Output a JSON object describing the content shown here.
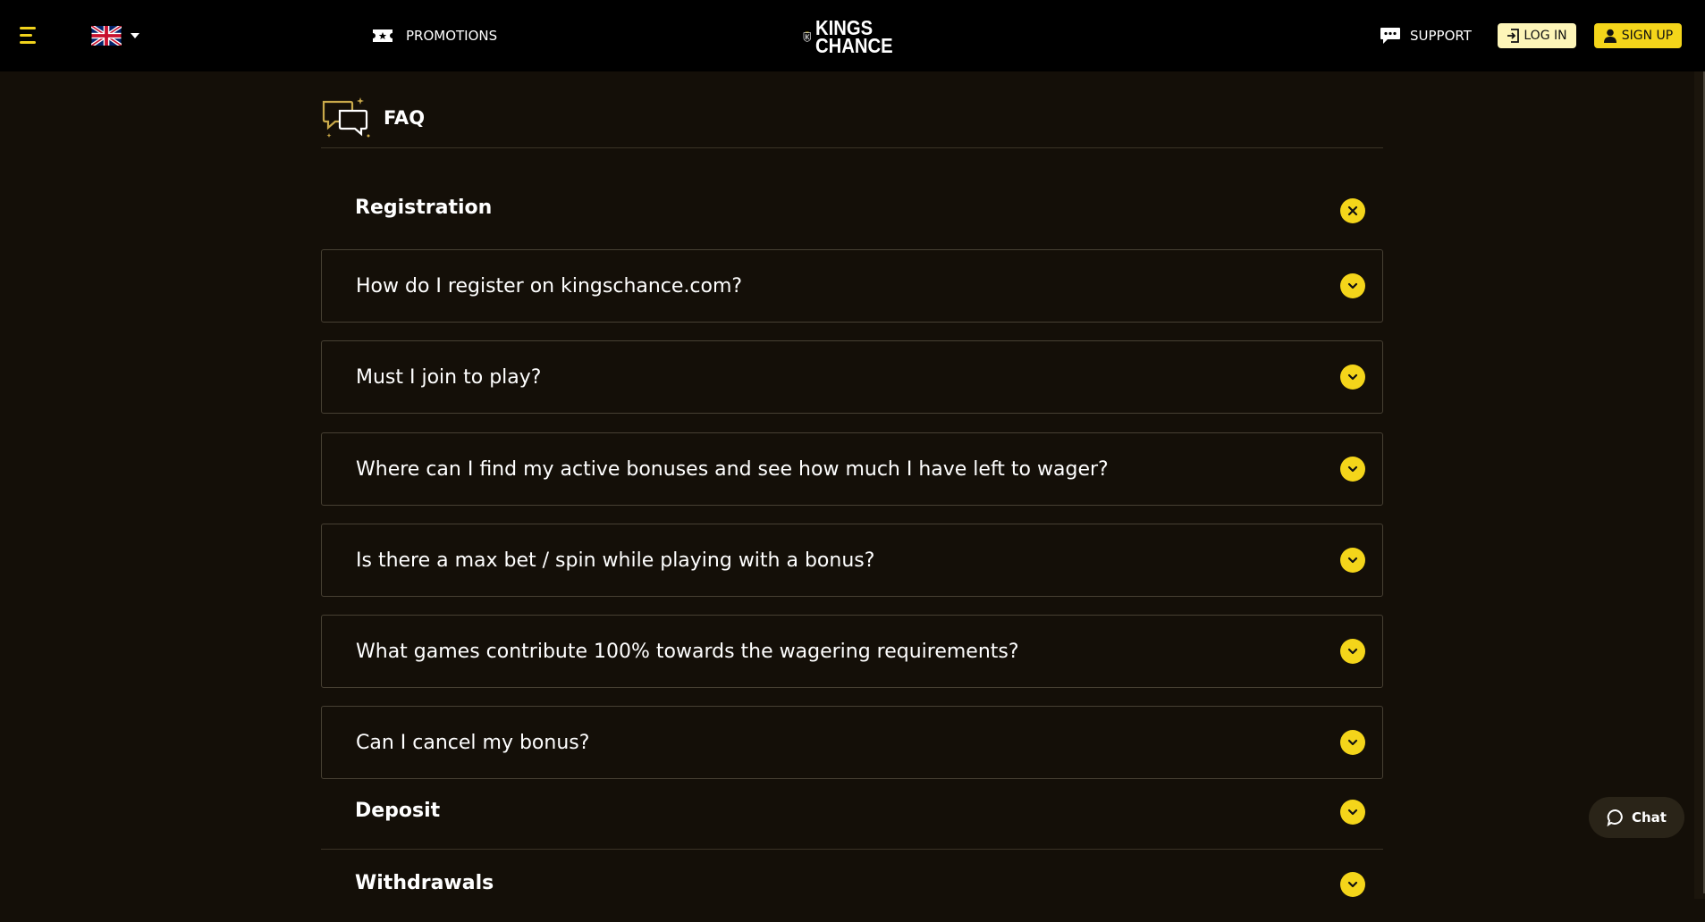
{
  "header": {
    "menu_icon": "hamburger-icon",
    "language_flag": "uk-flag-icon",
    "promotions_label": "PROMOTIONS",
    "logo_line1": "KINGS",
    "logo_line2": "CHANCE",
    "support_label": "SUPPORT",
    "login_label": "LOG IN",
    "signup_label": "SIGN UP",
    "accent_color": "#f4d51a"
  },
  "faq": {
    "title": "FAQ",
    "categories": [
      {
        "label": "Registration",
        "expanded": true,
        "questions": [
          "How do I register on kingschance.com?",
          "Must I join to play?",
          "Where can I find my active bonuses and see how much I have left to wager?",
          "Is there a max bet / spin while playing with a bonus?",
          "What games contribute 100% towards the wagering requirements?",
          "Can I cancel my bonus?"
        ]
      },
      {
        "label": "Deposit",
        "expanded": false
      },
      {
        "label": "Withdrawals",
        "expanded": false
      }
    ]
  },
  "chat": {
    "label": "Chat"
  }
}
